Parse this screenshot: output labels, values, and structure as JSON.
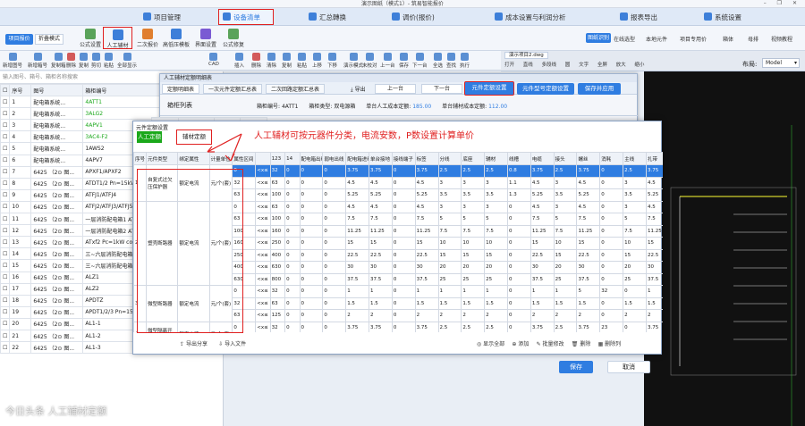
{
  "window": {
    "title": "演示图纸（模式1）- 筑易智能报价",
    "controls": "– ❐ ✕"
  },
  "menus": [
    {
      "label": "项目管理"
    },
    {
      "label": "设备清单"
    },
    {
      "label": "汇总轉换"
    },
    {
      "label": "调价(报价)"
    },
    {
      "label": "成本设置与利润分析"
    },
    {
      "label": "报表导出"
    },
    {
      "label": "系统设置"
    }
  ],
  "mode_buttons": {
    "project_report": "项目报价",
    "fold_mode": "折叠模式"
  },
  "toolbar1": [
    {
      "label": "公式设置"
    },
    {
      "label": "人工辅材"
    },
    {
      "label": "二次报价"
    },
    {
      "label": "高低压模板"
    },
    {
      "label": "界面设置"
    },
    {
      "label": "公式修复"
    }
  ],
  "toolbar1_right": [
    {
      "label": "图纸识别"
    },
    {
      "label": "在线选型"
    },
    {
      "label": "本地元件"
    },
    {
      "label": "项目专用价"
    },
    {
      "label": "箱体"
    },
    {
      "label": "母排"
    },
    {
      "label": "视频教程"
    }
  ],
  "toolbar2": [
    {
      "label": "新增图号"
    },
    {
      "label": "新增箱号"
    },
    {
      "label": "复制箱"
    },
    {
      "label": "删除"
    },
    {
      "label": "复制"
    },
    {
      "label": "剪切"
    },
    {
      "label": "粘贴"
    },
    {
      "label": "全部显示"
    },
    {
      "label": "CAD"
    },
    {
      "label": "插入"
    },
    {
      "label": "删除"
    },
    {
      "label": "清除"
    },
    {
      "label": "复制"
    },
    {
      "label": "粘贴"
    },
    {
      "label": "上移"
    },
    {
      "label": "下移"
    },
    {
      "label": "演示模式"
    },
    {
      "label": "未校对"
    },
    {
      "label": "上一台"
    },
    {
      "label": "保存"
    },
    {
      "label": "下一台"
    },
    {
      "label": "全选"
    },
    {
      "label": "查找"
    },
    {
      "label": "执行"
    }
  ],
  "cad": {
    "tab": "演示项目2.dwg",
    "layout_label": "布局:",
    "layout_value": "Model",
    "toolbar": [
      "打开",
      "直线",
      "多段线",
      "圆",
      "文字",
      "全屏",
      "放大",
      "缩小"
    ]
  },
  "left_panel": {
    "search_placeholder": "输入图号、箱号、箱柜名称搜索",
    "headers": [
      "序号",
      "图号",
      "箱柜编号"
    ],
    "rows": [
      {
        "no": "1",
        "fig": "配电箱系统...",
        "box": "4ATT1",
        "green": true
      },
      {
        "no": "2",
        "fig": "配电箱系统...",
        "box": "3ALG2",
        "green": true
      },
      {
        "no": "3",
        "fig": "配电箱系统...",
        "box": "4APV1",
        "green": true
      },
      {
        "no": "4",
        "fig": "配电箱系统...",
        "box": "3AC4-F2",
        "green": true
      },
      {
        "no": "5",
        "fig": "配电箱系统...",
        "box": "1AWS2",
        "green": false
      },
      {
        "no": "6",
        "fig": "配电箱系统...",
        "box": "4APV7",
        "green": false
      },
      {
        "no": "7",
        "fig": "6425 （2⊙ 图...",
        "box": "APXF1/APXF2",
        "green": false
      },
      {
        "no": "8",
        "fig": "6425 （2⊙ 图...",
        "box": "ATDT1/2 Pn=15kW Kd=1...",
        "green": false
      },
      {
        "no": "9",
        "fig": "6425 （2⊙ 图...",
        "box": "ATFJ1/ATFJ4",
        "green": false
      },
      {
        "no": "10",
        "fig": "6425 （2⊙ 图...",
        "box": "ATFJ2/ATFJ3/ATFJ5",
        "green": false
      },
      {
        "no": "11",
        "fig": "6425 （2⊙ 图...",
        "box": "一层消防配电箱1 ATxf1-1",
        "green": false
      },
      {
        "no": "12",
        "fig": "6425 （2⊙ 图...",
        "box": "一层消防配电箱2 ATxf1-2",
        "green": false
      },
      {
        "no": "13",
        "fig": "6425 （2⊙ 图...",
        "box": "ATxf2 Pc=1kW cosφ=0.8",
        "green": false
      },
      {
        "no": "14",
        "fig": "6425 （2⊙ 图...",
        "box": "三~六层消防配电箱1 ATxf...",
        "green": false
      },
      {
        "no": "15",
        "fig": "6425 （2⊙ 图...",
        "box": "三~六层消防配电箱2 ATxf...",
        "green": false
      },
      {
        "no": "16",
        "fig": "6425 （2⊙ 图...",
        "box": "ALZ1",
        "green": false
      },
      {
        "no": "17",
        "fig": "6425 （2⊙ 图...",
        "box": "ALZ2",
        "green": false
      },
      {
        "no": "18",
        "fig": "6425 （2⊙ 图...",
        "box": "APDTZ",
        "green": false
      },
      {
        "no": "19",
        "fig": "6425 （2⊙ 图...",
        "box": "APDT1/2/3 Pn=15kW Kd=1",
        "green": false
      },
      {
        "no": "20",
        "fig": "6425 （2⊙ 图...",
        "box": "AL1-1",
        "green": false
      },
      {
        "no": "21",
        "fig": "6425 （2⊙ 图...",
        "box": "AL1-2",
        "green": false
      },
      {
        "no": "22",
        "fig": "6425 （2⊙ 图...",
        "box": "AL1-3",
        "green": false
      }
    ]
  },
  "dialog1": {
    "title": "人工辅材定额明细表",
    "tabs": [
      "定额明细表",
      "一次元件定额汇总表",
      "二次回路定额汇总表"
    ],
    "export": "导出",
    "prev": "上一台",
    "next": "下一台",
    "btn_component_quota": "元件定额设置",
    "btn_model_quota": "元件型号定额设置",
    "btn_save_apply": "保存并应用",
    "box_list_label": "箱柜列表",
    "box_no_label": "箱柜编号:",
    "box_no_value": "4ATT1",
    "box_type_label": "箱柜类型:",
    "box_type_value": "双电源箱",
    "unit_cost_label": "单台人工成本定额:",
    "unit_cost_value": "185.00",
    "aux_cost_label": "单台辅材成本定额:",
    "aux_cost_value": "112.00",
    "list_headers": [
      "序号",
      "箱柜号",
      "图号",
      "数量"
    ]
  },
  "dialog2": {
    "title": "元件定额设置",
    "tab_labor": "人工定额",
    "tab_aux": "辅材定额",
    "annotation": "人工辅材可按元器件分类，电流安数，P数设置计算单价",
    "headers": [
      "序号",
      "元件类型",
      "绑定属性",
      "计量单位",
      "属性区间",
      "",
      "123",
      "14",
      "配电箱出线",
      "弱电出线",
      "配电箱进线",
      "单台接地",
      "接线端子",
      "标签",
      "分线",
      "底座",
      "辅材",
      "线槽",
      "电缆",
      "接头",
      "螺丝",
      "消耗",
      "主线",
      "扎带",
      "其他",
      "定制",
      "附件",
      "安装",
      "加工",
      "辅助",
      "调试",
      "运输"
    ],
    "groups": [
      {
        "no": "1",
        "type": "自复式过欠压保护器",
        "attr": "额定电流",
        "unit": "元/个(套)"
      },
      {
        "no": "2",
        "type": "塑壳断路器",
        "attr": "额定电流",
        "unit": "元/个(套)"
      },
      {
        "no": "3",
        "type": "微型断路器",
        "attr": "额定电流",
        "unit": "元/个(套)"
      },
      {
        "no": "4",
        "type": "微型隔离开关",
        "attr": "额定电流",
        "unit": "元/个(套)"
      }
    ],
    "rows": [
      [
        "0",
        "<x≤",
        "32",
        "0",
        "0",
        "0",
        "3.75",
        "3.75",
        "0",
        "3.75",
        "2.5",
        "2.5",
        "2.5",
        "0.8",
        "3.75",
        "2.5",
        "3.75",
        "0",
        "2.5",
        "3.75"
      ],
      [
        "32",
        "<x≤",
        "63",
        "0",
        "0",
        "0",
        "4.5",
        "4.5",
        "0",
        "4.5",
        "3",
        "3",
        "3",
        "1.1",
        "4.5",
        "3",
        "4.5",
        "0",
        "3",
        "4.5"
      ],
      [
        "63",
        "<x≤",
        "100",
        "0",
        "0",
        "0",
        "5.25",
        "5.25",
        "0",
        "5.25",
        "3.5",
        "3.5",
        "3.5",
        "1.3",
        "5.25",
        "3.5",
        "5.25",
        "0",
        "3.5",
        "5.25"
      ],
      [
        "0",
        "<x≤",
        "63",
        "0",
        "0",
        "0",
        "4.5",
        "4.5",
        "0",
        "4.5",
        "3",
        "3",
        "3",
        "0",
        "4.5",
        "3",
        "4.5",
        "0",
        "3",
        "4.5"
      ],
      [
        "63",
        "<x≤",
        "100",
        "0",
        "0",
        "0",
        "7.5",
        "7.5",
        "0",
        "7.5",
        "5",
        "5",
        "5",
        "0",
        "7.5",
        "5",
        "7.5",
        "0",
        "5",
        "7.5"
      ],
      [
        "100",
        "<x≤",
        "160",
        "0",
        "0",
        "0",
        "11.25",
        "11.25",
        "0",
        "11.25",
        "7.5",
        "7.5",
        "7.5",
        "0",
        "11.25",
        "7.5",
        "11.25",
        "0",
        "7.5",
        "11.25"
      ],
      [
        "160",
        "<x≤",
        "250",
        "0",
        "0",
        "0",
        "15",
        "15",
        "0",
        "15",
        "10",
        "10",
        "10",
        "0",
        "15",
        "10",
        "15",
        "0",
        "10",
        "15"
      ],
      [
        "250",
        "<x≤",
        "400",
        "0",
        "0",
        "0",
        "22.5",
        "22.5",
        "0",
        "22.5",
        "15",
        "15",
        "15",
        "0",
        "22.5",
        "15",
        "22.5",
        "0",
        "15",
        "22.5"
      ],
      [
        "400",
        "<x≤",
        "630",
        "0",
        "0",
        "0",
        "30",
        "30",
        "0",
        "30",
        "20",
        "20",
        "20",
        "0",
        "30",
        "20",
        "30",
        "0",
        "20",
        "30"
      ],
      [
        "630",
        "<x≤",
        "800",
        "0",
        "0",
        "0",
        "37.5",
        "37.5",
        "0",
        "37.5",
        "25",
        "25",
        "25",
        "0",
        "37.5",
        "25",
        "37.5",
        "0",
        "25",
        "37.5"
      ],
      [
        "0",
        "<x≤",
        "32",
        "0",
        "0",
        "0",
        "1",
        "1",
        "0",
        "1",
        "1",
        "1",
        "1",
        "0",
        "1",
        "1",
        "5",
        "32",
        "0",
        "1"
      ],
      [
        "32",
        "<x≤",
        "63",
        "0",
        "0",
        "0",
        "1.5",
        "1.5",
        "0",
        "1.5",
        "1.5",
        "1.5",
        "1.5",
        "0",
        "1.5",
        "1.5",
        "1.5",
        "0",
        "1.5",
        "1.5"
      ],
      [
        "63",
        "<x≤",
        "125",
        "0",
        "0",
        "0",
        "2",
        "2",
        "0",
        "2",
        "2",
        "2",
        "2",
        "0",
        "2",
        "2",
        "2",
        "0",
        "2",
        "2"
      ],
      [
        "0",
        "<x≤",
        "32",
        "0",
        "0",
        "0",
        "3.75",
        "3.75",
        "0",
        "3.75",
        "2.5",
        "2.5",
        "2.5",
        "0",
        "3.75",
        "2.5",
        "3.75",
        "23",
        "0",
        "3.75"
      ],
      [
        "32",
        "<x≤",
        "63",
        "0",
        "0",
        "0",
        "4.5",
        "4.5",
        "0",
        "4.5",
        "3",
        "3",
        "3",
        "0",
        "4.5",
        "3",
        "4.5",
        "0",
        "3",
        "4.5"
      ]
    ],
    "footer_left": [
      "导出分享",
      "导入文件"
    ],
    "footer_right": [
      "显示全部",
      "添加",
      "批量修改",
      "删除",
      "删除列"
    ],
    "save": "保存",
    "cancel": "取消"
  },
  "watermark": "今日头条 人工辅材定额",
  "colors": {
    "accent": "#2f7de1",
    "annotation": "#e02020",
    "green_text": "#1ba81b"
  }
}
